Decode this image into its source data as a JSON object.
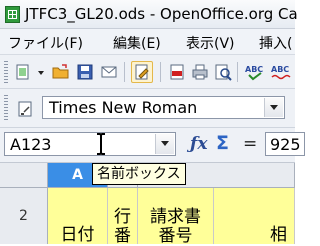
{
  "window": {
    "title": "JTFC3_GL20.ods - OpenOffice.org Ca"
  },
  "menu": {
    "items": [
      "ファイル(F)",
      "編集(E)",
      "表示(V)",
      "挿入("
    ]
  },
  "font_toolbar": {
    "font_name": "Times New Roman"
  },
  "formula_bar": {
    "name_box_value": "A123",
    "function_icon": "fx-icon",
    "sum_icon": "sigma-icon",
    "equals_label": "=",
    "input_value": "925"
  },
  "tooltip": {
    "text": "名前ボックス"
  },
  "sheet": {
    "column_headers": [
      "A",
      "",
      ""
    ],
    "row_number": "2",
    "cells": {
      "a": "日付",
      "b_line1": "行",
      "b_line2": "番",
      "c_line1": "請求書",
      "c_line2": "番号",
      "d": "相"
    }
  },
  "colors": {
    "accent": "#3a8ee6",
    "cell_highlight": "#ffff99",
    "tooltip_bg": "#ffffe1"
  }
}
